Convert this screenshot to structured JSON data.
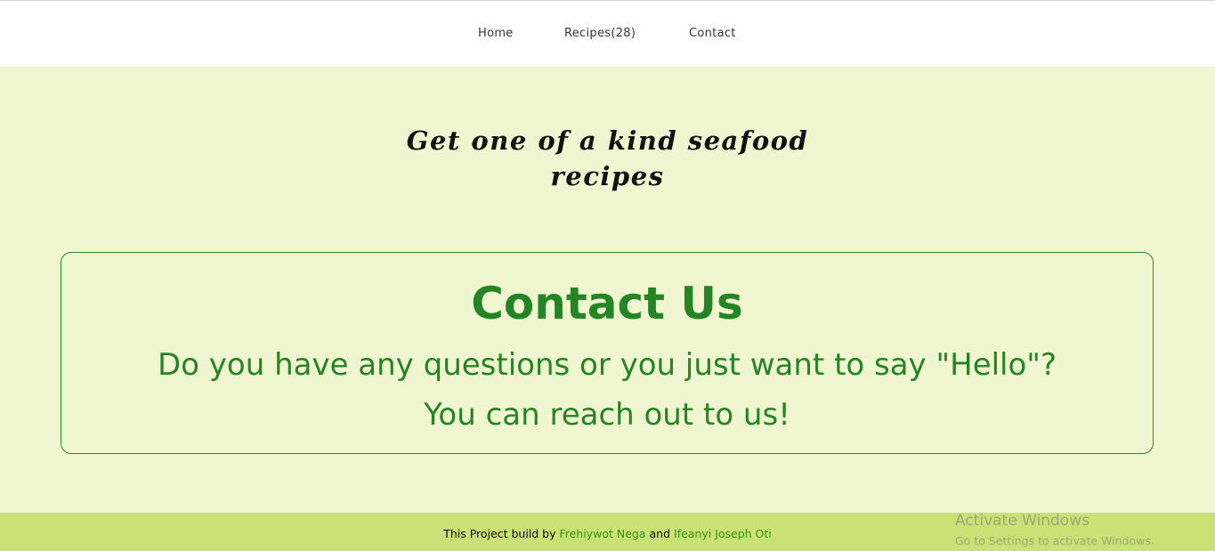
{
  "nav": {
    "items": [
      {
        "label": "Home"
      },
      {
        "label": "Recipes(28)"
      },
      {
        "label": "Contact"
      }
    ]
  },
  "hero": {
    "line1": "Get one of a kind seafood",
    "line2": "recipes"
  },
  "contact": {
    "heading": "Contact Us",
    "line1": "Do you have any questions or you just want to say \"Hello\"?",
    "line2": "You can reach out to us!"
  },
  "footer": {
    "prefix": "This Project build by ",
    "author1": "Frehiywot Nega",
    "joiner": " and ",
    "author2": "Ifeanyi Joseph Oti"
  },
  "watermark": {
    "title": "Activate Windows",
    "subtitle": "Go to Settings to activate Windows."
  },
  "colors": {
    "page_background": "#f0f7d0",
    "accent_green": "#238523",
    "footer_background": "#c9e276",
    "footer_link": "#3b8f1a"
  }
}
